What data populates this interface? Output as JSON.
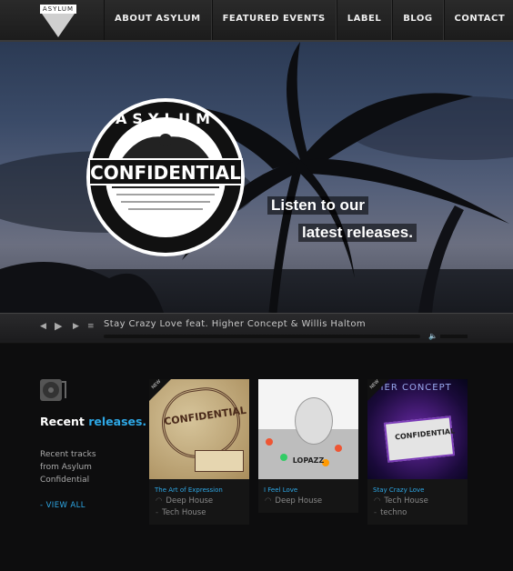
{
  "nav": {
    "logo_text": "ASYLUM",
    "items": [
      {
        "label": "ABOUT ASYLUM"
      },
      {
        "label": "FEATURED EVENTS"
      },
      {
        "label": "LABEL"
      },
      {
        "label": "BLOG"
      },
      {
        "label": "CONTACT"
      }
    ]
  },
  "hero": {
    "emblem_top": "ASYLUM",
    "emblem_title": "CONFIDENTIAL",
    "tagline_line1": "Listen to our",
    "tagline_line2": "latest releases."
  },
  "player": {
    "now_playing": "Stay Crazy Love feat. Higher Concept & Willis Haltom",
    "progress": 0
  },
  "releases": {
    "heading_main": "Recent",
    "heading_accent": "releases.",
    "description": "Recent tracks from Asylum Confidential",
    "view_all": "- VIEW ALL",
    "cards": [
      {
        "title": "The Art of Expression",
        "tags": [
          "Deep House",
          "Tech House"
        ],
        "new": true,
        "badge": "NEW",
        "cover_text": "CONFIDENTIAL"
      },
      {
        "title": "I Feel Love",
        "tags": [
          "Deep House"
        ],
        "new": false,
        "badge": "",
        "cover_text": "LOPAZZ"
      },
      {
        "title": "Stay Crazy Love",
        "tags": [
          "Tech House",
          "techno"
        ],
        "new": true,
        "badge": "NEW",
        "cover_text": "HER CONCEPT"
      }
    ]
  },
  "colors": {
    "accent": "#2ea8e6",
    "background": "#0d0d0e",
    "nav": "#222222"
  }
}
